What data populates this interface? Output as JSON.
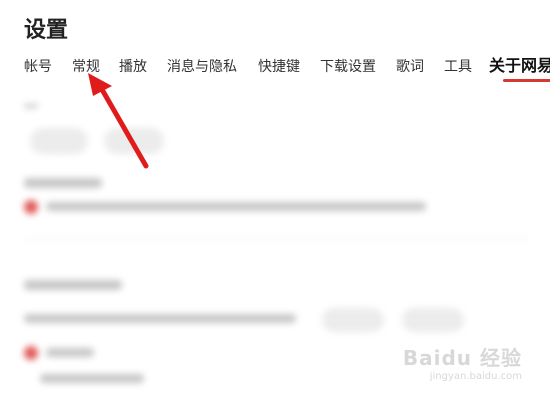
{
  "page": {
    "title": "设置"
  },
  "tabs": [
    {
      "label": "帐号"
    },
    {
      "label": "常规"
    },
    {
      "label": "播放"
    },
    {
      "label": "消息与隐私"
    },
    {
      "label": "快捷键"
    },
    {
      "label": "下载设置"
    },
    {
      "label": "歌词"
    },
    {
      "label": "工具"
    },
    {
      "label": "关于网易"
    }
  ],
  "active_tab": "关于网易",
  "colors": {
    "accent": "#d33a31",
    "arrow": "#e01b1b"
  },
  "watermark": {
    "main": "Baidu 经验",
    "sub": "jingyan.baidu.com"
  }
}
